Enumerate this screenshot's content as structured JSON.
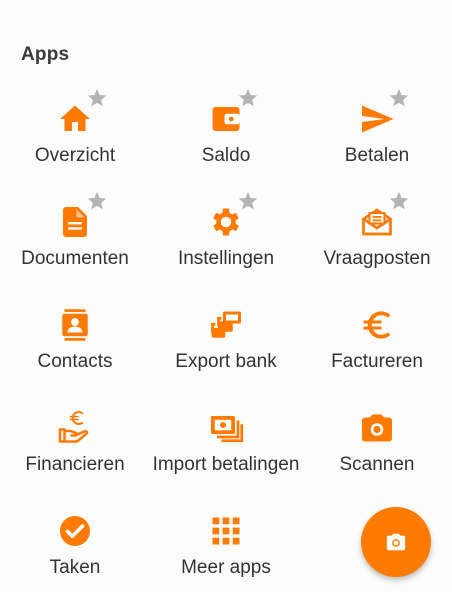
{
  "colors": {
    "accent": "#ff7a00",
    "star": "#b4b4b4",
    "text": "#333333"
  },
  "section": {
    "title": "Apps"
  },
  "apps": [
    {
      "label": "Overzicht",
      "icon": "home-icon",
      "favorite": true
    },
    {
      "label": "Saldo",
      "icon": "wallet-icon",
      "favorite": true
    },
    {
      "label": "Betalen",
      "icon": "send-icon",
      "favorite": true
    },
    {
      "label": "Documenten",
      "icon": "document-icon",
      "favorite": true
    },
    {
      "label": "Instellingen",
      "icon": "gear-icon",
      "favorite": true
    },
    {
      "label": "Vraagposten",
      "icon": "mail-question-icon",
      "favorite": true
    },
    {
      "label": "Contacts",
      "icon": "contact-card-icon",
      "favorite": false
    },
    {
      "label": "Export bank",
      "icon": "export-stack-icon",
      "favorite": false
    },
    {
      "label": "Factureren",
      "icon": "euro-icon",
      "favorite": false
    },
    {
      "label": "Financieren",
      "icon": "hand-euro-icon",
      "favorite": false
    },
    {
      "label": "Import betalingen",
      "icon": "cash-import-icon",
      "favorite": false
    },
    {
      "label": "Scannen",
      "icon": "camera-icon",
      "favorite": false
    },
    {
      "label": "Taken",
      "icon": "check-circle-icon",
      "favorite": false
    },
    {
      "label": "Meer apps",
      "icon": "grid-dots-icon",
      "favorite": false
    }
  ],
  "fab": {
    "icon": "camera-icon"
  }
}
